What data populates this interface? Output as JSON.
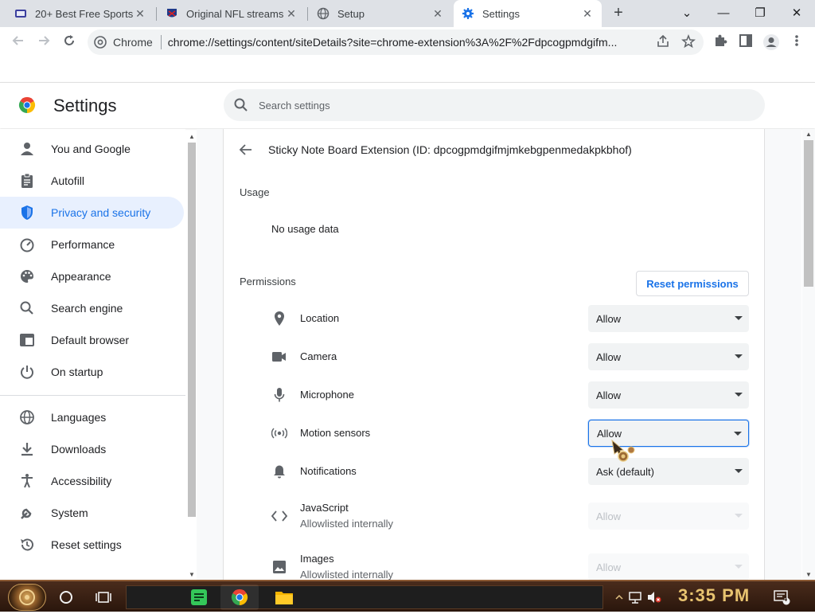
{
  "tabs": [
    {
      "title": "20+ Best Free Sports",
      "close": "✕"
    },
    {
      "title": "Original NFL streams",
      "close": "✕"
    },
    {
      "title": "Setup",
      "close": "✕"
    },
    {
      "title": "Settings",
      "close": "✕"
    }
  ],
  "window_controls": {
    "dropdown": "⌄",
    "minimize": "—",
    "restore": "❐",
    "close": "✕",
    "new_tab": "+"
  },
  "omnibox": {
    "chip": "Chrome",
    "url": "chrome://settings/content/siteDetails?site=chrome-extension%3A%2F%2Fdpcogpmdgifm..."
  },
  "header": {
    "title": "Settings",
    "search_placeholder": "Search settings"
  },
  "sidebar": {
    "items": [
      {
        "label": "You and Google",
        "icon": "person-icon"
      },
      {
        "label": "Autofill",
        "icon": "clipboard-icon"
      },
      {
        "label": "Privacy and security",
        "icon": "shield-icon",
        "selected": true
      },
      {
        "label": "Performance",
        "icon": "speedometer-icon"
      },
      {
        "label": "Appearance",
        "icon": "palette-icon"
      },
      {
        "label": "Search engine",
        "icon": "search-icon"
      },
      {
        "label": "Default browser",
        "icon": "browser-icon"
      },
      {
        "label": "On startup",
        "icon": "power-icon"
      },
      {
        "label": "Languages",
        "icon": "globe-icon"
      },
      {
        "label": "Downloads",
        "icon": "download-icon"
      },
      {
        "label": "Accessibility",
        "icon": "accessibility-icon"
      },
      {
        "label": "System",
        "icon": "wrench-icon"
      },
      {
        "label": "Reset settings",
        "icon": "reset-icon"
      }
    ]
  },
  "site": {
    "header": "Sticky Note Board Extension (ID: dpcogpmdgifmjmkebgpenmedakpkbhof)",
    "usage_title": "Usage",
    "usage_value": "No usage data",
    "permissions_title": "Permissions",
    "reset_label": "Reset permissions",
    "permissions": [
      {
        "label": "Location",
        "value": "Allow",
        "icon": "location-icon"
      },
      {
        "label": "Camera",
        "value": "Allow",
        "icon": "camera-icon"
      },
      {
        "label": "Microphone",
        "value": "Allow",
        "icon": "microphone-icon"
      },
      {
        "label": "Motion sensors",
        "value": "Allow",
        "icon": "motion-sensors-icon",
        "focused": true
      },
      {
        "label": "Notifications",
        "value": "Ask (default)",
        "icon": "bell-icon"
      },
      {
        "label": "JavaScript",
        "sub": "Allowlisted internally",
        "value": "Allow",
        "icon": "code-icon",
        "disabled": true
      },
      {
        "label": "Images",
        "sub": "Allowlisted internally",
        "value": "Allow",
        "icon": "image-icon",
        "disabled": true
      }
    ]
  },
  "taskbar": {
    "clock": "3:35 PM",
    "notification_count": "4"
  },
  "colors": {
    "accent": "#1a73e8",
    "selected_bg": "#e8f0fe",
    "taskbar": "#3a2214",
    "clock": "#e8c470"
  }
}
